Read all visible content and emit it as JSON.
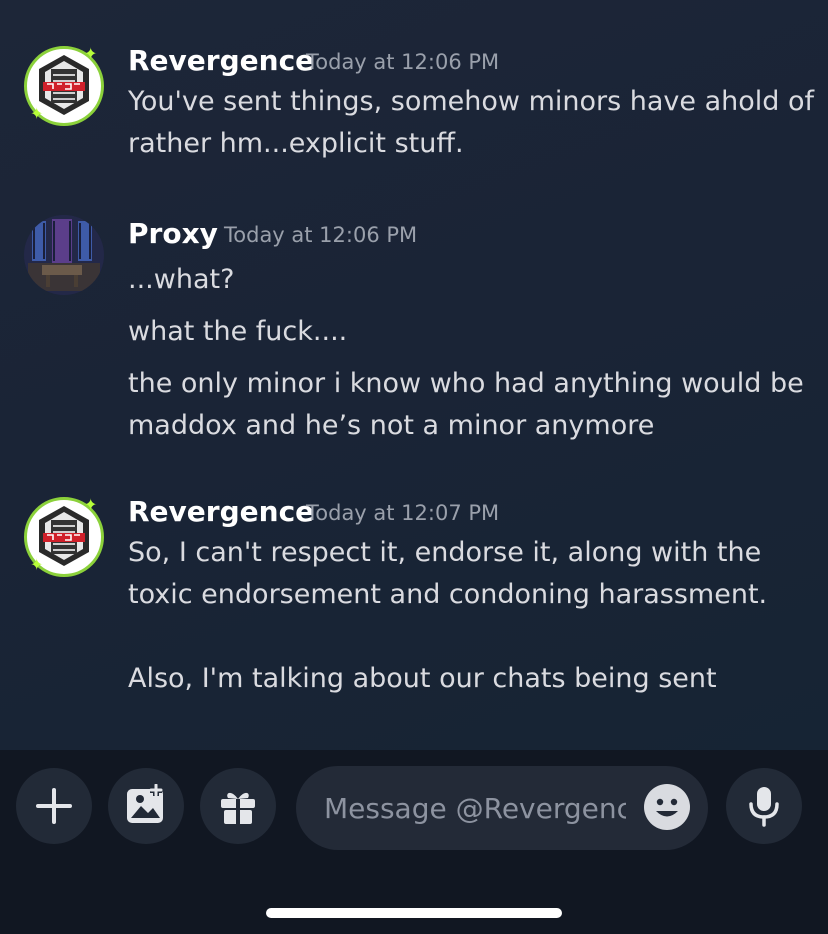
{
  "messages": [
    {
      "author": "Revergence",
      "time": "Today at 12:06 PM",
      "avatar": "revergence-logo",
      "lines": [
        "You've sent things, somehow minors have ahold of",
        "rather hm...explicit stuff."
      ]
    },
    {
      "author": "Proxy",
      "time": "Today at 12:06 PM",
      "avatar": "proxy-photo",
      "lines": [
        "...what?",
        "what the fuck....",
        "the only minor i know who had anything would be",
        "maddox and he’s not a minor anymore"
      ]
    },
    {
      "author": "Revergence",
      "time": "Today at 12:07 PM",
      "avatar": "revergence-logo",
      "lines": [
        "So, I can't respect it, endorse it, along with the",
        "toxic endorsement and condoning harassment.",
        "Also, I'm talking about our chats being sent"
      ]
    }
  ],
  "composer": {
    "placeholder": "Message @Revergence",
    "buttons": [
      "plus-icon",
      "image-icon",
      "gift-icon",
      "mic-icon"
    ],
    "emoji_icon": "smiley-icon"
  },
  "colors": {
    "background": "#1a2436",
    "composer_bg": "#111722",
    "accent_green": "#8bd13a"
  }
}
